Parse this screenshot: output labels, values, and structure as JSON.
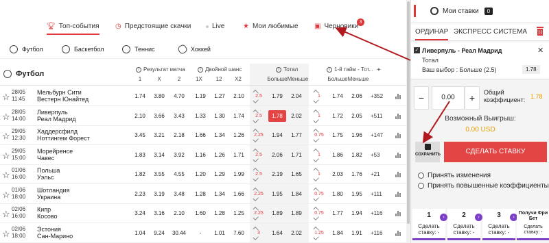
{
  "topnav": {
    "items": [
      {
        "label": "Топ-события",
        "icon": "trophy-icon"
      },
      {
        "label": "Предстоящие скачки",
        "icon": "clock-icon"
      },
      {
        "label": "Live",
        "icon": "live-dot-icon"
      },
      {
        "label": "Мои любимые",
        "icon": "star-icon"
      },
      {
        "label": "Черновики",
        "icon": "save-disk-icon"
      }
    ],
    "drafts_badge": "3"
  },
  "sports": [
    {
      "label": "Футбол",
      "icon": "football-icon"
    },
    {
      "label": "Баскетбол",
      "icon": "basketball-icon"
    },
    {
      "label": "Теннис",
      "icon": "tennis-icon"
    },
    {
      "label": "Хоккей",
      "icon": "hockey-icon"
    }
  ],
  "table": {
    "title": "Футбол",
    "groups": {
      "result": "Результат матча",
      "double": "Двойной шанс",
      "total": "Тотал",
      "half": "1-й тайм - Тот...",
      "plus": "+"
    },
    "subheads": {
      "r1": "1",
      "rx": "X",
      "r2": "2",
      "d1x": "1X",
      "d12": "12",
      "dx2": "X2",
      "tmore": "Больше",
      "tless": "Меньше",
      "hmore": "Больше",
      "hless": "Меньше"
    },
    "rows": [
      {
        "date": "28/05",
        "time": "11:45",
        "home": "Мельбурн Сити",
        "away": "Вестерн Юнайтед",
        "r1": "1.74",
        "rx": "3.80",
        "r2": "4.70",
        "d1x": "1.19",
        "d12": "1.27",
        "dx2": "2.10",
        "tline": "2.5",
        "tmore": "1.79",
        "tless": "2.04",
        "hline": "1",
        "hmore": "1.74",
        "hless": "2.06",
        "count": "+352"
      },
      {
        "date": "28/05",
        "time": "14:00",
        "home": "Ливерпуль",
        "away": "Реал Мадрид",
        "r1": "2.10",
        "rx": "3.66",
        "r2": "3.43",
        "d1x": "1.33",
        "d12": "1.30",
        "dx2": "1.74",
        "tline": "2.5",
        "tmore": "1.78",
        "tless": "2.02",
        "hline": "1",
        "hmore": "1.72",
        "hless": "2.05",
        "count": "+511"
      },
      {
        "date": "29/05",
        "time": "12:30",
        "home": "Хаддерсфилд",
        "away": "Ноттингем Форест",
        "r1": "3.45",
        "rx": "3.21",
        "r2": "2.18",
        "d1x": "1.66",
        "d12": "1.34",
        "dx2": "1.26",
        "tline": "2.25",
        "tmore": "1.94",
        "tless": "1.77",
        "hline": "0.75",
        "hmore": "1.75",
        "hless": "1.96",
        "count": "+147"
      },
      {
        "date": "29/05",
        "time": "15:00",
        "home": "Морейренсе",
        "away": "Чавес",
        "r1": "1.83",
        "rx": "3.14",
        "r2": "3.92",
        "d1x": "1.16",
        "d12": "1.26",
        "dx2": "1.71",
        "tline": "2.5",
        "tmore": "2.06",
        "tless": "1.71",
        "hline": "1",
        "hmore": "1.86",
        "hless": "1.82",
        "count": "+53"
      },
      {
        "date": "01/06",
        "time": "16:00",
        "home": "Польша",
        "away": "Уэльс",
        "r1": "1.82",
        "rx": "3.55",
        "r2": "4.55",
        "d1x": "1.20",
        "d12": "1.29",
        "dx2": "1.99",
        "tline": "2.5",
        "tmore": "2.19",
        "tless": "1.65",
        "hline": "1",
        "hmore": "2.03",
        "hless": "1.76",
        "count": "+21"
      },
      {
        "date": "01/06",
        "time": "18:00",
        "home": "Шотландия",
        "away": "Украина",
        "r1": "2.23",
        "rx": "3.19",
        "r2": "3.48",
        "d1x": "1.28",
        "d12": "1.34",
        "dx2": "1.66",
        "tline": "2.25",
        "tmore": "1.95",
        "tless": "1.84",
        "hline": "0.75",
        "hmore": "1.80",
        "hless": "1.95",
        "count": "+111"
      },
      {
        "date": "02/06",
        "time": "16:00",
        "home": "Кипр",
        "away": "Косово",
        "r1": "3.24",
        "rx": "3.16",
        "r2": "2.10",
        "d1x": "1.60",
        "d12": "1.28",
        "dx2": "1.25",
        "tline": "2.25",
        "tmore": "1.89",
        "tless": "1.89",
        "hline": "0.75",
        "hmore": "1.77",
        "hless": "1.94",
        "count": "+116"
      },
      {
        "date": "02/06",
        "time": "18:00",
        "home": "Эстония",
        "away": "Сан-Марино",
        "r1": "1.04",
        "rx": "9.24",
        "r2": "30.44",
        "d1x": "-",
        "d12": "1.01",
        "dx2": "7.60",
        "tline": "3",
        "tmore": "1.64",
        "tless": "2.02",
        "hline": "1.25",
        "hmore": "1.84",
        "hless": "1.91",
        "count": "+116"
      }
    ]
  },
  "betslip": {
    "title": "Мои ставки",
    "count": "0",
    "tabs": [
      "ОРДИНАР",
      "ЭКСПРЕСС",
      "СИСТЕМА"
    ],
    "match": "Ливерпуль - Реал Мадрид",
    "market": "Тотал",
    "pick": "Ваш выбор : Больше (2.5)",
    "pick_odd": "1.78",
    "stake": "0.00",
    "minus": "−",
    "plus": "+",
    "coef_label": "Общий коэффициент:",
    "coef_value": "1.78",
    "win_label": "Возможный Выигрыш:",
    "win_value": "0.00 USD",
    "save_label": "СОХРАНИТЬ",
    "make_bet_label": "СДЕЛАТЬ СТАВКУ",
    "opt_accept": "Принять изменения",
    "opt_accept_higher": "Принять повышенные коэффициенты",
    "cards": [
      {
        "num": "1",
        "label": "Сделать ставку: -"
      },
      {
        "num": "2",
        "label": "Сделать ставку: -"
      },
      {
        "num": "3",
        "label": "Сделать ставку: -"
      }
    ],
    "freebet_label": "Получи Фри Бет",
    "freebet_sub": "Сделать ставку: -"
  },
  "colors": {
    "accent": "#e0363a",
    "highlight": "#e34444",
    "coef": "#e8a000",
    "card": "#7c3fc7"
  }
}
